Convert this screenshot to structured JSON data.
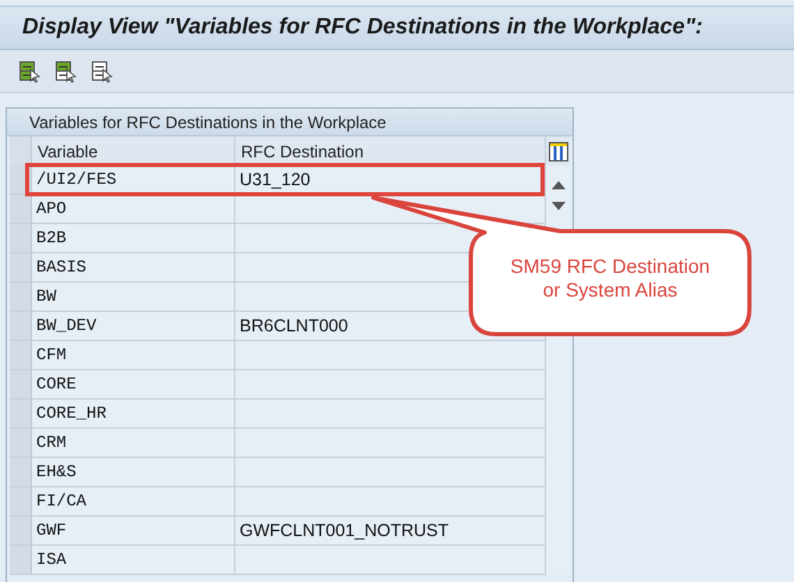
{
  "window": {
    "title": "Display View \"Variables for RFC Destinations in the Workplace\":"
  },
  "toolbar": {
    "buttons": [
      {
        "kind": "green"
      },
      {
        "kind": "half"
      },
      {
        "kind": "plain"
      }
    ]
  },
  "table": {
    "title": "Variables for RFC Destinations in the Workplace",
    "columns": [
      "Variable",
      "RFC Destination"
    ],
    "rows": [
      {
        "cells": [
          "/UI2/FES",
          "U31_120"
        ],
        "highlighted": true
      },
      {
        "cells": [
          "APO",
          ""
        ],
        "highlighted": false
      },
      {
        "cells": [
          "B2B",
          ""
        ],
        "highlighted": false
      },
      {
        "cells": [
          "BASIS",
          ""
        ],
        "highlighted": false
      },
      {
        "cells": [
          "BW",
          ""
        ],
        "highlighted": false
      },
      {
        "cells": [
          "BW_DEV",
          "BR6CLNT000"
        ],
        "highlighted": false
      },
      {
        "cells": [
          "CFM",
          ""
        ],
        "highlighted": false
      },
      {
        "cells": [
          "CORE",
          ""
        ],
        "highlighted": false
      },
      {
        "cells": [
          "CORE_HR",
          ""
        ],
        "highlighted": false
      },
      {
        "cells": [
          "CRM",
          ""
        ],
        "highlighted": false
      },
      {
        "cells": [
          "EH&S",
          ""
        ],
        "highlighted": false
      },
      {
        "cells": [
          "FI/CA",
          ""
        ],
        "highlighted": false
      },
      {
        "cells": [
          "GWF",
          "GWFCLNT001_NOTRUST"
        ],
        "highlighted": false
      },
      {
        "cells": [
          "ISA",
          ""
        ],
        "highlighted": false
      }
    ]
  },
  "callout": {
    "lines": [
      "SM59 RFC Destination",
      "or System Alias"
    ]
  }
}
